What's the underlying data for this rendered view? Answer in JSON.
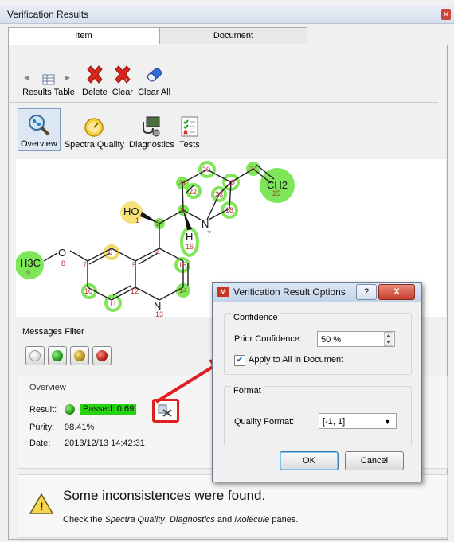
{
  "window": {
    "title": "Verification Results"
  },
  "tabs": [
    {
      "label": "Item"
    },
    {
      "label": "Document"
    }
  ],
  "toolbar1": {
    "results_table": "Results Table",
    "delete": "Delete",
    "clear": "Clear",
    "clear_all": "Clear All"
  },
  "toolbar2": {
    "overview": "Overview",
    "spectra_quality": "Spectra Quality",
    "diagnostics": "Diagnostics",
    "tests": "Tests"
  },
  "molecule": {
    "atoms": [
      {
        "label": "HO",
        "num": "1"
      },
      {
        "num": "2"
      },
      {
        "num": "3"
      },
      {
        "num": "4"
      },
      {
        "num": "5"
      },
      {
        "num": "6"
      },
      {
        "num": "7"
      },
      {
        "label": "O",
        "num": "8"
      },
      {
        "label": "H3C",
        "num": "9"
      },
      {
        "num": "10"
      },
      {
        "num": "11"
      },
      {
        "num": "12"
      },
      {
        "label": "N",
        "num": "13"
      },
      {
        "num": "14"
      },
      {
        "num": "15"
      },
      {
        "label": "H",
        "num": "16"
      },
      {
        "label": "N",
        "num": "17"
      },
      {
        "num": "18"
      },
      {
        "num": "19"
      },
      {
        "num": "20"
      },
      {
        "num": "21"
      },
      {
        "num": "22"
      },
      {
        "num": "23"
      },
      {
        "num": "24"
      },
      {
        "label": "CH2",
        "num": "25"
      }
    ]
  },
  "messages_filter": {
    "label": "Messages Filter"
  },
  "overview": {
    "heading": "Overview",
    "result_label": "Result:",
    "result_value": "Passed: 0.69",
    "purity_label": "Purity:",
    "purity_value": "98.41%",
    "date_label": "Date:",
    "date_value": "2013/12/13 14:42:31"
  },
  "warning": {
    "title": "Some inconsistences were found.",
    "detail_prefix": "Check the ",
    "detail_link1": "Spectra Quality",
    "detail_sep": ", ",
    "detail_link2": "Diagnostics",
    "detail_and": " and ",
    "detail_link3": "Molecule",
    "detail_suffix": " panes."
  },
  "dialog": {
    "title": "Verification Result Options",
    "help": "?",
    "close": "X",
    "confidence_group": "Confidence",
    "prior_label": "Prior Confidence:",
    "prior_value": "50 %",
    "apply_all": "Apply to All in Document",
    "apply_all_checked": true,
    "format_group": "Format",
    "quality_label": "Quality Format:",
    "quality_value": "[-1, 1]",
    "ok": "OK",
    "cancel": "Cancel"
  }
}
